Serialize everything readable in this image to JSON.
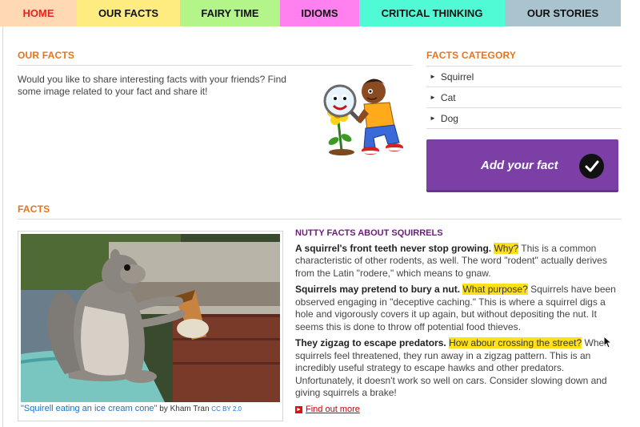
{
  "nav": [
    {
      "label": "HOME",
      "bg": "#ffd9b3",
      "color": "#e8251c",
      "width": 96
    },
    {
      "label": "OUR FACTS",
      "bg": "#ffec80",
      "color": "#111111",
      "width": 129
    },
    {
      "label": "FAIRY TIME",
      "bg": "#b4f58a",
      "color": "#111111",
      "width": 125
    },
    {
      "label": "IDIOMS",
      "bg": "#ff80ee",
      "color": "#111111",
      "width": 99
    },
    {
      "label": "CRITICAL THINKING",
      "bg": "#50fad4",
      "color": "#111111",
      "width": 182
    },
    {
      "label": "OUR STORIES",
      "bg": "#a9c3cf",
      "color": "#111111",
      "width": 145
    }
  ],
  "our_facts": {
    "title": "OUR FACTS",
    "intro": "Would you like to share interesting facts with your friends? Find some image related to your fact and share it!"
  },
  "category": {
    "title": "FACTS CATEGORY",
    "items": [
      "Squirrel",
      "Cat",
      "Dog"
    ]
  },
  "add_button": {
    "label": "Add your fact"
  },
  "facts": {
    "title": "FACTS",
    "caption_link": "\"Squirell eating an ice cream cone\"",
    "caption_by": "by Kham Tran",
    "caption_license": "CC BY 2.0",
    "heading": "NUTTY FACTS ABOUT SQUIRRELS",
    "items": [
      {
        "bold": "A squirrel's front teeth never stop growing.",
        "highlight": "Why?",
        "text": "This is a common characteristic of other rodents, as well. The word \"rodent\" actually derives from the Latin \"rodere,\" which means to gnaw."
      },
      {
        "bold": "Squirrels may pretend to bury a nut.",
        "highlight": "What purpose?",
        "text": "Squirrels have been observed engaging in \"deceptive caching.\" This is where a squirrel digs a hole and vigorously covers it up again, but without depositing the nut. It seems this is done to throw off potential food thieves."
      },
      {
        "bold": "They zigzag to escape predators.",
        "highlight": "How abour crossing the street?",
        "text": "When squirrels feel threatened, they run away in a zigzag pattern. This is an incredibly useful strategy to escape hawks and other predators. Unfortunately, it doesn't work so well on cars. Consider slowing down and giving squirrels a brake!"
      }
    ],
    "find_more": "Find out more"
  },
  "colors": {
    "accent": "#e8731e",
    "button": "#7b3fa6",
    "heading_purple": "#6b1d7a",
    "highlight": "#ffe11a"
  }
}
